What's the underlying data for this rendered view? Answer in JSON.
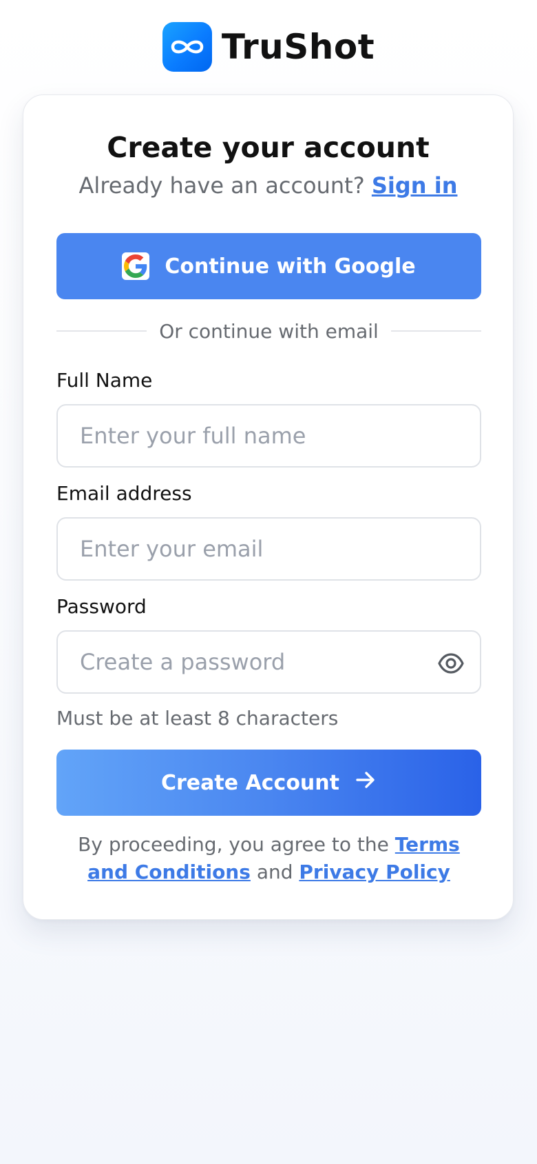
{
  "brand": {
    "name": "TruShot",
    "logo_icon": "infinity-icon",
    "logo_color": "#0a7cff"
  },
  "header": {
    "title": "Create your account",
    "signin_prompt": "Already have an account?",
    "signin_link": "Sign in"
  },
  "google": {
    "label": "Continue with Google",
    "icon": "google-g-icon",
    "button_color": "#4a86f0"
  },
  "divider": {
    "text": "Or continue with email"
  },
  "form": {
    "full_name": {
      "label": "Full Name",
      "placeholder": "Enter your full name",
      "value": ""
    },
    "email": {
      "label": "Email address",
      "placeholder": "Enter your email",
      "value": ""
    },
    "password": {
      "label": "Password",
      "placeholder": "Create a password",
      "value": "",
      "toggle_icon": "eye-icon",
      "hint": "Must be at least 8 characters"
    }
  },
  "submit": {
    "label": "Create Account",
    "icon": "arrow-right-icon"
  },
  "legal": {
    "prefix": "By proceeding, you agree to the",
    "terms_link": "Terms and Conditions",
    "conjunction": "and",
    "privacy_link": "Privacy Policy",
    "link_color": "#3d7ae6"
  }
}
